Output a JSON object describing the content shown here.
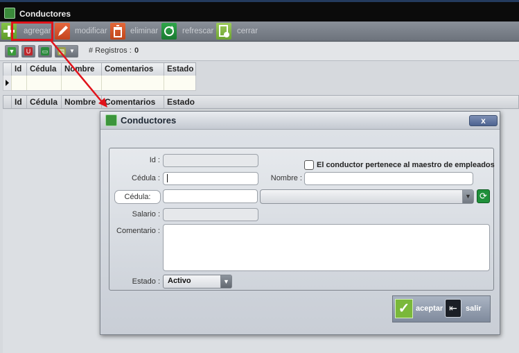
{
  "window": {
    "title": "Conductores"
  },
  "toolbar": {
    "add": "agregar",
    "modify": "modificar",
    "delete": "eliminar",
    "refresh": "refrescar",
    "close": "cerrar"
  },
  "gridbar": {
    "records_label": "# Registros :",
    "records_value": "0"
  },
  "grid": {
    "columns": [
      "Id",
      "Cédula",
      "Nombre",
      "Comentarios",
      "Estado"
    ]
  },
  "dialog": {
    "title": "Conductores",
    "close_label": "x",
    "labels": {
      "id": "Id :",
      "cedula": "Cédula :",
      "nombre": "Nombre :",
      "salario": "Salario :",
      "comentario": "Comentario :",
      "estado": "Estado :"
    },
    "checkbox_label": "El conductor pertenece al maestro de empleados",
    "cedula_button": "Cédula:",
    "estado_value": "Activo",
    "accept": "aceptar",
    "exit": "salir"
  },
  "colors": {
    "annotation": "#e0131b",
    "accept": "#7ab83a",
    "refresh": "#1f8f3a"
  }
}
